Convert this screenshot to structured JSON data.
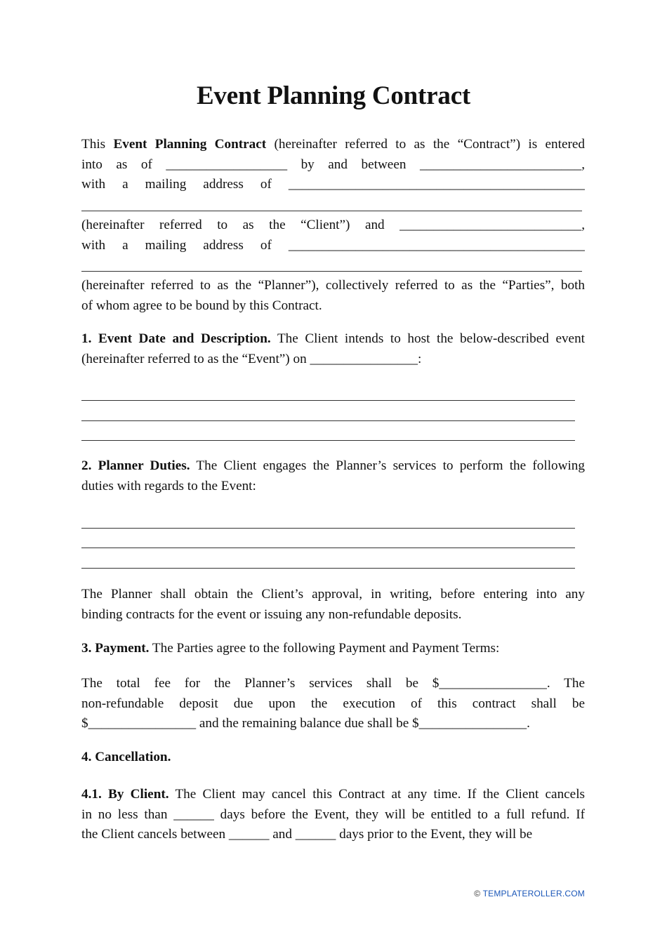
{
  "document": {
    "title": "Event Planning Contract",
    "intro": {
      "l1_a": "This ",
      "l1_b": "Event Planning Contract",
      "l1_c": " (hereinafter referred to as the “Contract”) is entered",
      "l2": "into as of __________________ by and between ________________________,",
      "l3": "with a mailing address of ____________________________________________",
      "l4": "________________________________________________________________",
      "l5": "(hereinafter referred to as the “Client”) and ___________________________,",
      "l6": "with a mailing address of ____________________________________________",
      "l7": "________________________________________________________________",
      "l8": "(hereinafter referred to as the “Planner”), collectively referred to as the “Parties”, both",
      "l9": "of whom agree to be bound by this Contract."
    },
    "section1": {
      "heading": "1. Event Date and Description.",
      "l1": " The Client intends to host the below-described event",
      "l2": "(hereinafter referred to as the “Event”) on ________________:"
    },
    "section2": {
      "heading": "2. Planner Duties.",
      "l1": " The Client engages the Planner’s services to perform the following",
      "l2": "duties with regards to the Event:",
      "p2_l1": "The Planner shall obtain the Client’s approval, in writing, before entering into any",
      "p2_l2": "binding contracts for the event or issuing any non-refundable deposits."
    },
    "section3": {
      "heading": "3. Payment.",
      "l1": " The Parties agree to the following Payment and Payment Terms:",
      "p2_l1": "The total fee for the Planner’s services shall be $________________. The",
      "p2_l2": "non-refundable deposit due upon the execution of this contract shall be",
      "p2_l3": "$________________ and the remaining balance due shall be $________________."
    },
    "section4": {
      "heading": "4. Cancellation."
    },
    "section4_1": {
      "heading": "4.1. By Client.",
      "l1": " The Client may cancel this Contract at any time. If the Client cancels",
      "l2": "in no less than ______ days before the Event, they will be entitled to a full refund. If",
      "l3": "the Client cancels between ______ and ______ days prior to the Event, they will be"
    }
  },
  "footer": {
    "copyright_symbol": "©",
    "brand": " TEMPLATEROLLER.COM"
  },
  "colors": {
    "text": "#111111",
    "footer_link": "#1a56b8"
  }
}
